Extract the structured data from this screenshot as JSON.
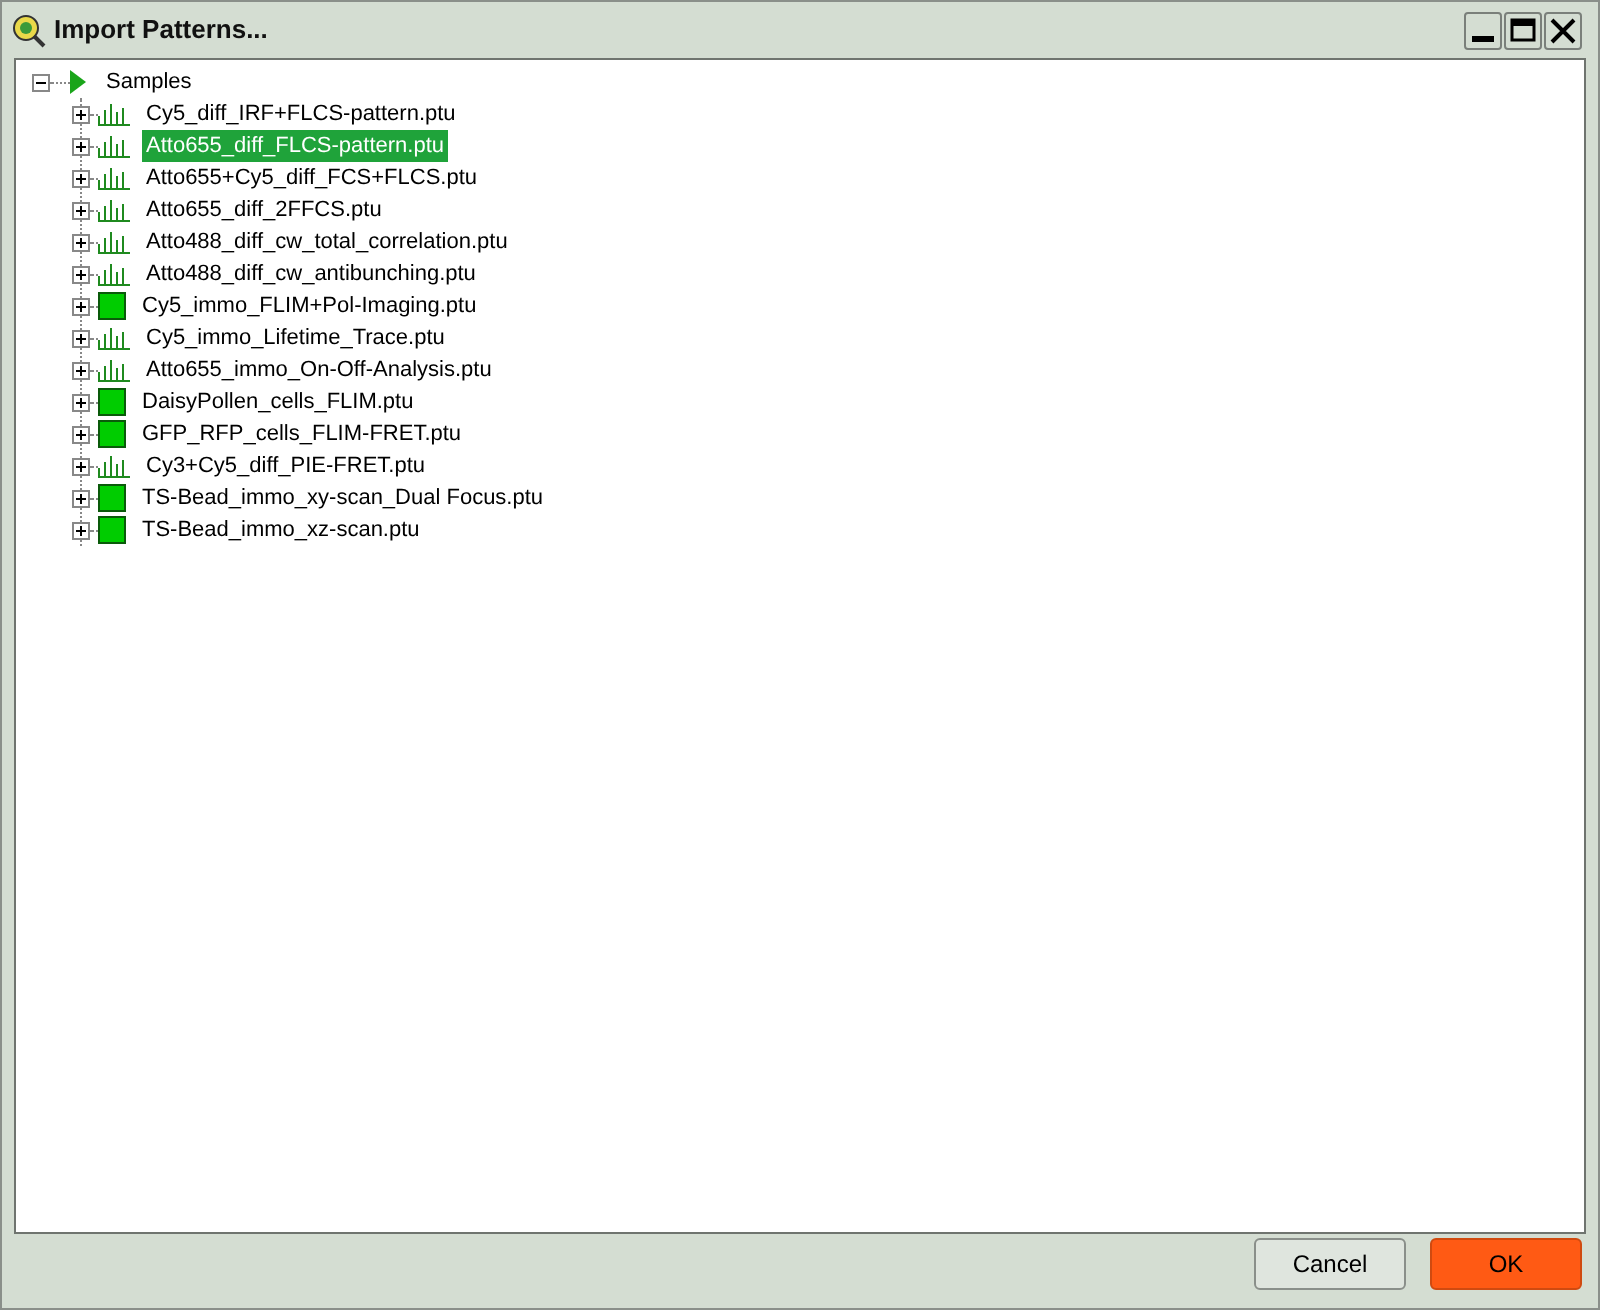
{
  "window": {
    "title": "Import Patterns..."
  },
  "tree": {
    "label": "Samples",
    "expanded": true,
    "children": [
      {
        "label": "Cy5_diff_IRF+FLCS-pattern.ptu",
        "kind": "trace",
        "expanded": false,
        "selected": false
      },
      {
        "label": "Atto655_diff_FLCS-pattern.ptu",
        "kind": "trace",
        "expanded": false,
        "selected": true
      },
      {
        "label": "Atto655+Cy5_diff_FCS+FLCS.ptu",
        "kind": "trace",
        "expanded": false,
        "selected": false
      },
      {
        "label": "Atto655_diff_2FFCS.ptu",
        "kind": "trace",
        "expanded": false,
        "selected": false
      },
      {
        "label": "Atto488_diff_cw_total_correlation.ptu",
        "kind": "trace",
        "expanded": false,
        "selected": false
      },
      {
        "label": "Atto488_diff_cw_antibunching.ptu",
        "kind": "trace",
        "expanded": false,
        "selected": false
      },
      {
        "label": "Cy5_immo_FLIM+Pol-Imaging.ptu",
        "kind": "image",
        "expanded": false,
        "selected": false
      },
      {
        "label": "Cy5_immo_Lifetime_Trace.ptu",
        "kind": "trace",
        "expanded": false,
        "selected": false
      },
      {
        "label": "Atto655_immo_On-Off-Analysis.ptu",
        "kind": "trace",
        "expanded": false,
        "selected": false
      },
      {
        "label": "DaisyPollen_cells_FLIM.ptu",
        "kind": "image",
        "expanded": false,
        "selected": false
      },
      {
        "label": "GFP_RFP_cells_FLIM-FRET.ptu",
        "kind": "image",
        "expanded": false,
        "selected": false
      },
      {
        "label": "Cy3+Cy5_diff_PIE-FRET.ptu",
        "kind": "trace",
        "expanded": false,
        "selected": false
      },
      {
        "label": "TS-Bead_immo_xy-scan_Dual Focus.ptu",
        "kind": "image",
        "expanded": false,
        "selected": false
      },
      {
        "label": "TS-Bead_immo_xz-scan.ptu",
        "kind": "image",
        "expanded": false,
        "selected": false
      }
    ]
  },
  "buttons": [
    {
      "label": "Cancel",
      "kind": "secondary"
    },
    {
      "label": "OK",
      "kind": "primary"
    }
  ]
}
